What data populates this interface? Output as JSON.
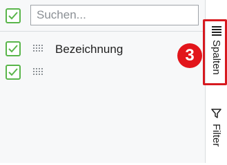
{
  "header": {
    "select_all_checked": true,
    "search": {
      "placeholder": "Suchen...",
      "value": ""
    }
  },
  "columns": [
    {
      "label": "Bezeichnung",
      "checked": true,
      "icon": "drag-grip-icon"
    },
    {
      "label": "",
      "checked": true,
      "icon": "drag-grip-icon"
    }
  ],
  "sidebar": {
    "tabs": [
      {
        "label": "Spalten",
        "icon": "columns-icon",
        "active": true
      },
      {
        "label": "Filter",
        "icon": "filter-icon",
        "active": false
      }
    ]
  },
  "callout": {
    "number": "3"
  },
  "colors": {
    "check_green": "#59b54a",
    "callout_red": "#e2151b"
  }
}
